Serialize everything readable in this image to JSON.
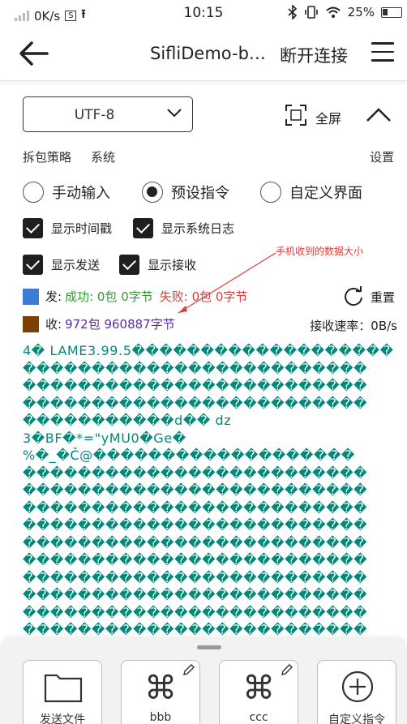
{
  "status_bar": {
    "network_speed": "0K/s",
    "time": "10:15",
    "battery_percent": "25%",
    "icons": [
      "signal-icon",
      "sim-s-icon",
      "upload-icon",
      "bluetooth-icon",
      "vibrate-icon",
      "wifi-icon",
      "battery-icon"
    ]
  },
  "app_bar": {
    "title": "SifliDemo-b…",
    "disconnect_label": "断开连接"
  },
  "controls": {
    "encoding": "UTF-8",
    "fullscreen_label": "全屏",
    "packet_strategy_label": "拆包策略",
    "packet_strategy_value": "系统",
    "settings_label": "设置"
  },
  "modes": [
    {
      "label": "手动输入",
      "selected": false
    },
    {
      "label": "预设指令",
      "selected": true
    },
    {
      "label": "自定义界面",
      "selected": false
    }
  ],
  "options": [
    {
      "label": "显示时间戳",
      "checked": true
    },
    {
      "label": "显示系统日志",
      "checked": true
    },
    {
      "label": "显示发送",
      "checked": true
    },
    {
      "label": "显示接收",
      "checked": true
    }
  ],
  "annotation": "手机收到的数据大小",
  "send_stats": {
    "prefix": "发:",
    "success": "成功: 0包 0字节",
    "fail": "失败: 0包 0字节",
    "color": "#3a7bd5"
  },
  "reset_label": "重置",
  "recv_stats": {
    "prefix": "收:",
    "value": "972包 960887字节",
    "color": "#7b3f00"
  },
  "receive_rate": "接收速率：0B/s",
  "log_lines": [
    "4� LAME3.99.5�������������������",
    "�������������������������",
    "�������������������������",
    "�������������������������",
    "�����������d�� dz",
    "3�BF�*=\"yMU0�Ge�",
    "%�_�Č@�������������������",
    "�������������������������",
    "�������������������������",
    "�������������������������",
    "�������������������������",
    "�������������������������",
    "�������������������������",
    "�������������������������",
    "�������������������������",
    "�������������������������",
    "�������������������������"
  ],
  "commands": [
    {
      "label": "发送文件",
      "icon": "folder-icon"
    },
    {
      "label": "bbb",
      "icon": "command-icon"
    },
    {
      "label": "ccc",
      "icon": "command-icon"
    },
    {
      "label": "自定义指令",
      "icon": "add-circle-icon"
    }
  ]
}
